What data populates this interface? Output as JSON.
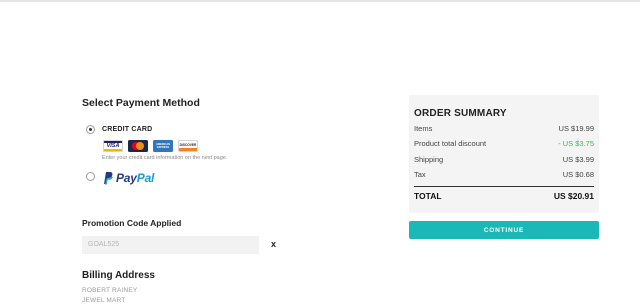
{
  "payment": {
    "title": "Select Payment Method",
    "credit_card_label": "CREDIT CARD",
    "credit_card_selected": true,
    "card_icons": [
      "visa-card-icon",
      "mastercard-icon",
      "american-express-icon",
      "discover-card-icon"
    ],
    "card_texts": {
      "visa": "VISA",
      "amex": "AMERICAN EXPRESS",
      "discover": "DISCOVER"
    },
    "credit_card_hint": "Enter your credit card information on the next page.",
    "paypal_selected": false,
    "paypal": {
      "pay": "Pay",
      "pal": "Pal"
    }
  },
  "promo": {
    "title": "Promotion Code Applied",
    "code_value": "GOAL525",
    "remove_label": "x"
  },
  "billing": {
    "title": "Billing Address",
    "lines": [
      "ROBERT RAINEY",
      "JEWEL MART"
    ]
  },
  "summary": {
    "title": "ORDER SUMMARY",
    "rows": [
      {
        "label": "Items",
        "value": "US $19.99"
      },
      {
        "label": "Product total discount",
        "value": "- US $3.75"
      },
      {
        "label": "Shipping",
        "value": "US $3.99"
      },
      {
        "label": "Tax",
        "value": "US $0.68"
      }
    ],
    "total_label": "TOTAL",
    "total_value": "US $20.91",
    "colors": {
      "discount": "#3bb85a",
      "panel": "#f4f4f4"
    }
  },
  "continue_label": "CONTINUE",
  "colors": {
    "accent": "#1bb8b8",
    "paypal_dark": "#253b80",
    "paypal_light": "#179bd7"
  }
}
